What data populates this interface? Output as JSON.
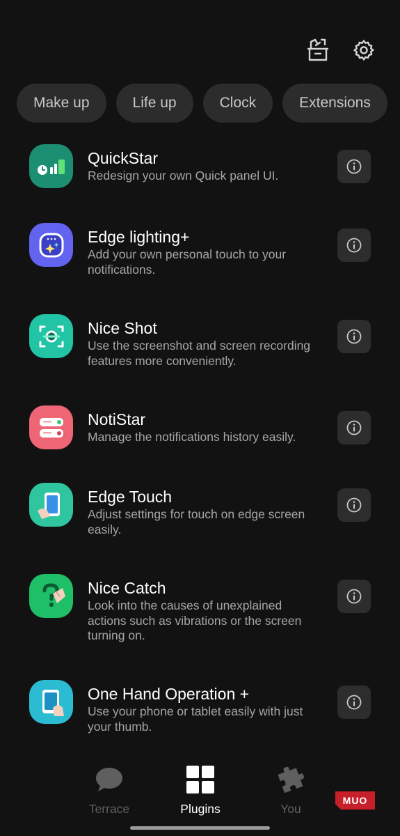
{
  "top_actions": [
    {
      "icon": "archive-box-icon"
    },
    {
      "icon": "gear-icon"
    }
  ],
  "chips": [
    {
      "label": "Make up"
    },
    {
      "label": "Life up"
    },
    {
      "label": "Clock"
    },
    {
      "label": "Extensions"
    }
  ],
  "plugins": [
    {
      "name": "QuickStar",
      "description": "Redesign your own Quick panel UI.",
      "icon": "quickstar-icon",
      "color": "#1c8f72"
    },
    {
      "name": "Edge lighting+",
      "description": "Add your own personal touch to your notifications.",
      "icon": "edge-lighting-icon",
      "color": "#6264f0"
    },
    {
      "name": "Nice Shot",
      "description": "Use the screenshot and screen recording features more conveniently.",
      "icon": "nice-shot-icon",
      "color": "#21c4a5"
    },
    {
      "name": "NotiStar",
      "description": "Manage the notifications history easily.",
      "icon": "notistar-icon",
      "color": "#ee6576"
    },
    {
      "name": "Edge Touch",
      "description": "Adjust settings for touch on edge screen easily.",
      "icon": "edge-touch-icon",
      "color": "#2ec59f"
    },
    {
      "name": "Nice Catch",
      "description": "Look into the causes of unexplained actions such as vibrations or the screen turning on.",
      "icon": "nice-catch-icon",
      "color": "#1fbf67"
    },
    {
      "name": "One Hand Operation +",
      "description": "Use your phone or tablet easily with just your thumb.",
      "icon": "one-hand-operation-icon",
      "color": "#2bbcd3"
    }
  ],
  "bottom_nav": [
    {
      "label": "Terrace",
      "icon": "chat-bubble-icon",
      "active": false
    },
    {
      "label": "Plugins",
      "icon": "grid-icon",
      "active": true
    },
    {
      "label": "You",
      "icon": "puzzle-piece-icon",
      "active": false
    }
  ],
  "watermark": "MUO"
}
